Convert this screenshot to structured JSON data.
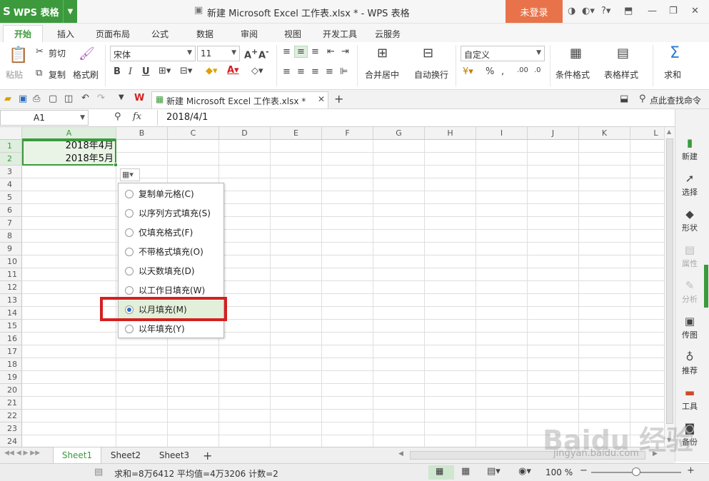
{
  "app": {
    "name": "WPS 表格",
    "logo": "S",
    "doc_title": "新建 Microsoft Excel 工作表.xlsx * - WPS 表格",
    "login": "未登录"
  },
  "ribbon_tabs": [
    "开始",
    "插入",
    "页面布局",
    "公式",
    "数据",
    "审阅",
    "视图",
    "开发工具",
    "云服务"
  ],
  "ribbon": {
    "paste": "粘贴",
    "cut": "剪切",
    "copy": "复制",
    "format_painter": "格式刷",
    "font_name": "宋体",
    "font_size": "11",
    "merge_center": "合并居中",
    "wrap_text": "自动换行",
    "number_format": "自定义",
    "conditional_format": "条件格式",
    "table_style": "表格样式",
    "sum": "求和"
  },
  "quick_access": {
    "doc_tab": "新建 Microsoft Excel 工作表.xlsx *",
    "search": "点此查找命令"
  },
  "formula_bar": {
    "name_box": "A1",
    "fx": "fx",
    "formula": "2018/4/1"
  },
  "columns": [
    "A",
    "B",
    "C",
    "D",
    "E",
    "F",
    "G",
    "H",
    "I",
    "J",
    "K",
    "L"
  ],
  "rows": [
    "1",
    "2",
    "3",
    "4",
    "5",
    "6",
    "7",
    "8",
    "9",
    "10",
    "11",
    "12",
    "13",
    "14",
    "15",
    "16",
    "17",
    "18",
    "19",
    "20",
    "21",
    "22",
    "23",
    "24"
  ],
  "cells": {
    "A1": "2018年4月",
    "A2": "2018年5月"
  },
  "fill_options": [
    {
      "label": "复制单元格(C)",
      "selected": false
    },
    {
      "label": "以序列方式填充(S)",
      "selected": false
    },
    {
      "label": "仅填充格式(F)",
      "selected": false
    },
    {
      "label": "不带格式填充(O)",
      "selected": false
    },
    {
      "label": "以天数填充(D)",
      "selected": false
    },
    {
      "label": "以工作日填充(W)",
      "selected": false
    },
    {
      "label": "以月填充(M)",
      "selected": true
    },
    {
      "label": "以年填充(Y)",
      "selected": false
    }
  ],
  "right_panel": [
    "新建",
    "选择",
    "形状",
    "属性",
    "分析",
    "传图",
    "推荐",
    "工具",
    "备份"
  ],
  "sheet_tabs": [
    "Sheet1",
    "Sheet2",
    "Sheet3"
  ],
  "status": {
    "summary": "求和=8万6412  平均值=4万3206  计数=2",
    "zoom": "100 %"
  },
  "watermark": {
    "main": "Baidu 经验",
    "sub": "jingyan.baidu.com"
  },
  "colors": {
    "accent": "#3c9a3c",
    "login": "#e8734a",
    "highlight": "#d42020"
  }
}
